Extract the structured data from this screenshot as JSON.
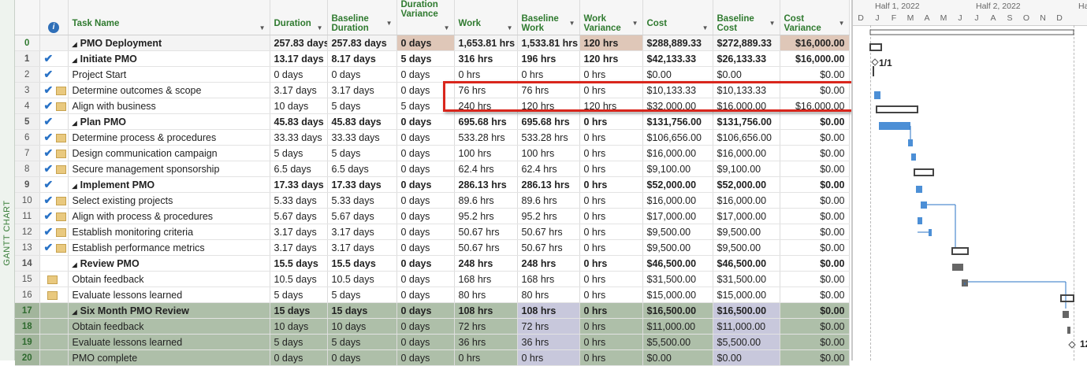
{
  "sidebar": {
    "label": "GANTT CHART"
  },
  "columns": {
    "task_name": "Task Name",
    "duration": "Duration",
    "baseline_duration": "Baseline Duration",
    "duration_variance": "Duration Variance",
    "work": "Work",
    "baseline_work": "Baseline Work",
    "work_variance": "Work Variance",
    "cost": "Cost",
    "baseline_cost": "Baseline Cost",
    "cost_variance": "Cost Variance"
  },
  "rows": [
    {
      "id": "0",
      "name": "PMO Deployment",
      "duration": "257.83 days",
      "bduration": "257.83 days",
      "dvar": "0 days",
      "work": "1,653.81 hrs",
      "bwork": "1,533.81 hrs",
      "wvar": "120 hrs",
      "cost": "$288,889.33",
      "bcost": "$272,889.33",
      "cvar": "$16,000.00"
    },
    {
      "id": "1",
      "name": "Initiate PMO",
      "duration": "13.17 days",
      "bduration": "8.17 days",
      "dvar": "5 days",
      "work": "316 hrs",
      "bwork": "196 hrs",
      "wvar": "120 hrs",
      "cost": "$42,133.33",
      "bcost": "$26,133.33",
      "cvar": "$16,000.00"
    },
    {
      "id": "2",
      "name": "Project Start",
      "duration": "0 days",
      "bduration": "0 days",
      "dvar": "0 days",
      "work": "0 hrs",
      "bwork": "0 hrs",
      "wvar": "0 hrs",
      "cost": "$0.00",
      "bcost": "$0.00",
      "cvar": "$0.00"
    },
    {
      "id": "3",
      "name": "Determine outcomes & scope",
      "duration": "3.17 days",
      "bduration": "3.17 days",
      "dvar": "0 days",
      "work": "76 hrs",
      "bwork": "76 hrs",
      "wvar": "0 hrs",
      "cost": "$10,133.33",
      "bcost": "$10,133.33",
      "cvar": "$0.00"
    },
    {
      "id": "4",
      "name": "Align with business",
      "duration": "10 days",
      "bduration": "5 days",
      "dvar": "5 days",
      "work": "240 hrs",
      "bwork": "120 hrs",
      "wvar": "120 hrs",
      "cost": "$32,000.00",
      "bcost": "$16,000.00",
      "cvar": "$16,000.00"
    },
    {
      "id": "5",
      "name": "Plan PMO",
      "duration": "45.83 days",
      "bduration": "45.83 days",
      "dvar": "0 days",
      "work": "695.68 hrs",
      "bwork": "695.68 hrs",
      "wvar": "0 hrs",
      "cost": "$131,756.00",
      "bcost": "$131,756.00",
      "cvar": "$0.00"
    },
    {
      "id": "6",
      "name": "Determine process & procedures",
      "duration": "33.33 days",
      "bduration": "33.33 days",
      "dvar": "0 days",
      "work": "533.28 hrs",
      "bwork": "533.28 hrs",
      "wvar": "0 hrs",
      "cost": "$106,656.00",
      "bcost": "$106,656.00",
      "cvar": "$0.00"
    },
    {
      "id": "7",
      "name": "Design communication campaign",
      "duration": "5 days",
      "bduration": "5 days",
      "dvar": "0 days",
      "work": "100 hrs",
      "bwork": "100 hrs",
      "wvar": "0 hrs",
      "cost": "$16,000.00",
      "bcost": "$16,000.00",
      "cvar": "$0.00"
    },
    {
      "id": "8",
      "name": "Secure management sponsorship",
      "duration": "6.5 days",
      "bduration": "6.5 days",
      "dvar": "0 days",
      "work": "62.4 hrs",
      "bwork": "62.4 hrs",
      "wvar": "0 hrs",
      "cost": "$9,100.00",
      "bcost": "$9,100.00",
      "cvar": "$0.00"
    },
    {
      "id": "9",
      "name": "Implement PMO",
      "duration": "17.33 days",
      "bduration": "17.33 days",
      "dvar": "0 days",
      "work": "286.13 hrs",
      "bwork": "286.13 hrs",
      "wvar": "0 hrs",
      "cost": "$52,000.00",
      "bcost": "$52,000.00",
      "cvar": "$0.00"
    },
    {
      "id": "10",
      "name": "Select existing projects",
      "duration": "5.33 days",
      "bduration": "5.33 days",
      "dvar": "0 days",
      "work": "89.6 hrs",
      "bwork": "89.6 hrs",
      "wvar": "0 hrs",
      "cost": "$16,000.00",
      "bcost": "$16,000.00",
      "cvar": "$0.00"
    },
    {
      "id": "11",
      "name": "Align with process & procedures",
      "duration": "5.67 days",
      "bduration": "5.67 days",
      "dvar": "0 days",
      "work": "95.2 hrs",
      "bwork": "95.2 hrs",
      "wvar": "0 hrs",
      "cost": "$17,000.00",
      "bcost": "$17,000.00",
      "cvar": "$0.00"
    },
    {
      "id": "12",
      "name": "Establish monitoring criteria",
      "duration": "3.17 days",
      "bduration": "3.17 days",
      "dvar": "0 days",
      "work": "50.67 hrs",
      "bwork": "50.67 hrs",
      "wvar": "0 hrs",
      "cost": "$9,500.00",
      "bcost": "$9,500.00",
      "cvar": "$0.00"
    },
    {
      "id": "13",
      "name": "Establish performance metrics",
      "duration": "3.17 days",
      "bduration": "3.17 days",
      "dvar": "0 days",
      "work": "50.67 hrs",
      "bwork": "50.67 hrs",
      "wvar": "0 hrs",
      "cost": "$9,500.00",
      "bcost": "$9,500.00",
      "cvar": "$0.00"
    },
    {
      "id": "14",
      "name": "Review PMO",
      "duration": "15.5 days",
      "bduration": "15.5 days",
      "dvar": "0 days",
      "work": "248 hrs",
      "bwork": "248 hrs",
      "wvar": "0 hrs",
      "cost": "$46,500.00",
      "bcost": "$46,500.00",
      "cvar": "$0.00"
    },
    {
      "id": "15",
      "name": "Obtain feedback",
      "duration": "10.5 days",
      "bduration": "10.5 days",
      "dvar": "0 days",
      "work": "168 hrs",
      "bwork": "168 hrs",
      "wvar": "0 hrs",
      "cost": "$31,500.00",
      "bcost": "$31,500.00",
      "cvar": "$0.00"
    },
    {
      "id": "16",
      "name": "Evaluate lessons learned",
      "duration": "5 days",
      "bduration": "5 days",
      "dvar": "0 days",
      "work": "80 hrs",
      "bwork": "80 hrs",
      "wvar": "0 hrs",
      "cost": "$15,000.00",
      "bcost": "$15,000.00",
      "cvar": "$0.00"
    },
    {
      "id": "17",
      "name": "Six Month PMO Review",
      "duration": "15 days",
      "bduration": "15 days",
      "dvar": "0 days",
      "work": "108 hrs",
      "bwork": "108 hrs",
      "wvar": "0 hrs",
      "cost": "$16,500.00",
      "bcost": "$16,500.00",
      "cvar": "$0.00"
    },
    {
      "id": "18",
      "name": "Obtain feedback",
      "duration": "10 days",
      "bduration": "10 days",
      "dvar": "0 days",
      "work": "72 hrs",
      "bwork": "72 hrs",
      "wvar": "0 hrs",
      "cost": "$11,000.00",
      "bcost": "$11,000.00",
      "cvar": "$0.00"
    },
    {
      "id": "19",
      "name": "Evaluate lessons learned",
      "duration": "5 days",
      "bduration": "5 days",
      "dvar": "0 days",
      "work": "36 hrs",
      "bwork": "36 hrs",
      "wvar": "0 hrs",
      "cost": "$5,500.00",
      "bcost": "$5,500.00",
      "cvar": "$0.00"
    },
    {
      "id": "20",
      "name": "PMO complete",
      "duration": "0 days",
      "bduration": "0 days",
      "dvar": "0 days",
      "work": "0 hrs",
      "bwork": "0 hrs",
      "wvar": "0 hrs",
      "cost": "$0.00",
      "bcost": "$0.00",
      "cvar": "$0.00"
    }
  ],
  "gantt": {
    "half1": "Half 1, 2022",
    "half2": "Half 2, 2022",
    "half3": "Ha",
    "months": [
      "D",
      "J",
      "F",
      "M",
      "A",
      "M",
      "J",
      "J",
      "A",
      "S",
      "O",
      "N",
      "D"
    ],
    "milestone_start": "1/1",
    "milestone_end": "12"
  }
}
